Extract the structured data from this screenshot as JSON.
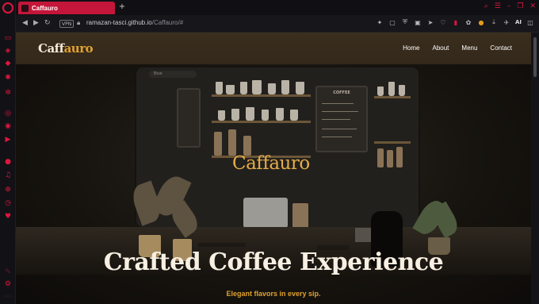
{
  "browser": {
    "tab": {
      "title": "Caffauro"
    },
    "newtab_icon": "+",
    "address": {
      "vpn_label": "VPN",
      "url_host": "ramazan-tasci.github.io",
      "url_path": "/Caffauro/#"
    },
    "toolbar": {
      "ai_label": "AI"
    },
    "accent_color": "#e0163f"
  },
  "site": {
    "brand_main": "Caff",
    "brand_accent": "auro",
    "nav": [
      "Home",
      "About",
      "Menu",
      "Contact"
    ],
    "scene_logo": "Caffauro",
    "scene_search": "Bow",
    "menu_board_title": "COFFEE",
    "hero_title": "Crafted Coffee Experience",
    "hero_subtitle": "Elegant flavors in every sip.",
    "accent_color": "#e0a12e"
  }
}
